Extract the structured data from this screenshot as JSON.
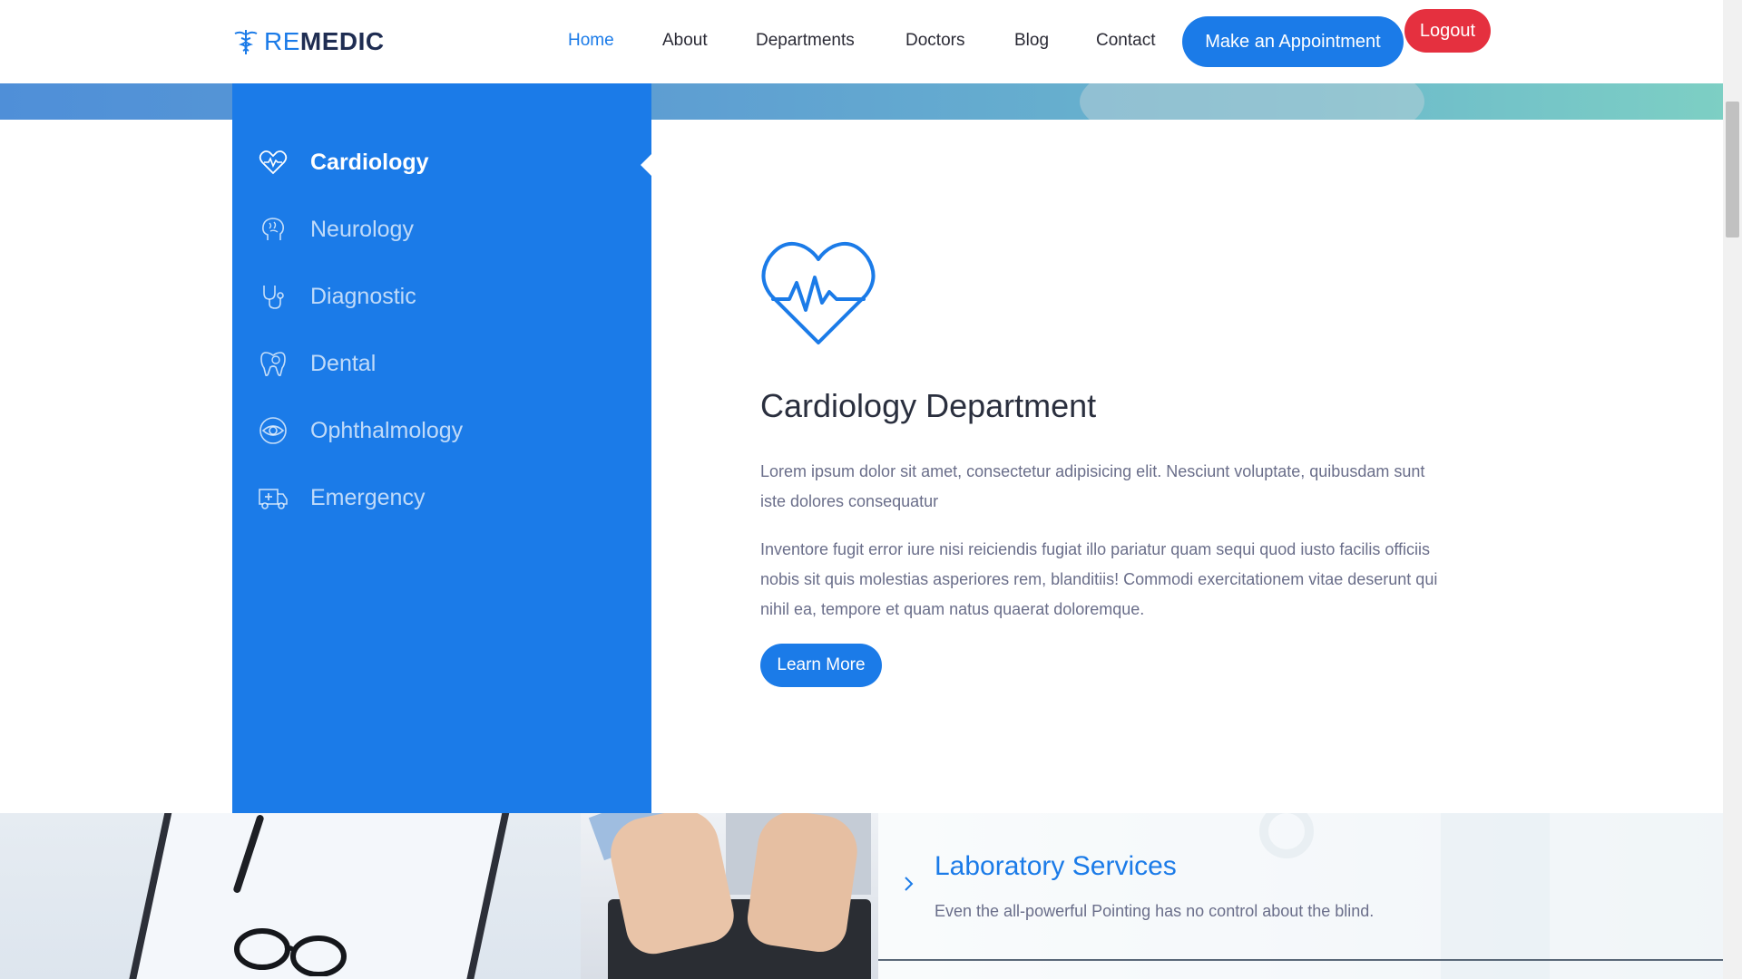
{
  "logo": {
    "part1": "RE",
    "part2": "MEDIC"
  },
  "nav": {
    "links": [
      {
        "label": "Home",
        "active": true
      },
      {
        "label": "About"
      },
      {
        "label": "Departments"
      },
      {
        "label": "Doctors"
      },
      {
        "label": "Blog"
      },
      {
        "label": "Contact"
      }
    ],
    "appointment_label": "Make an Appointment",
    "logout_label": "Logout"
  },
  "departments": {
    "items": [
      {
        "label": "Cardiology",
        "icon": "heart-pulse-icon",
        "active": true
      },
      {
        "label": "Neurology",
        "icon": "brain-icon"
      },
      {
        "label": "Diagnostic",
        "icon": "stethoscope-icon"
      },
      {
        "label": "Dental",
        "icon": "tooth-icon"
      },
      {
        "label": "Ophthalmology",
        "icon": "eye-icon"
      },
      {
        "label": "Emergency",
        "icon": "ambulance-icon"
      }
    ],
    "detail": {
      "title": "Cardiology Department",
      "paragraph1": "Lorem ipsum dolor sit amet, consectetur adipisicing elit. Nesciunt voluptate, quibusdam sunt iste dolores consequatur",
      "paragraph2": "Inventore fugit error iure nisi reiciendis fugiat illo pariatur quam sequi quod iusto facilis officiis nobis sit quis molestias asperiores rem, blanditiis! Commodi exercitationem vitae deserunt qui nihil ea, tempore et quam natus quaerat doloremque.",
      "button_label": "Learn More"
    }
  },
  "services": {
    "title": "Laboratory Services",
    "text": "Even the all-powerful Pointing has no control about the blind."
  },
  "colors": {
    "primary": "#1b7be8",
    "danger": "#e5303f",
    "heading": "#2a2f3e",
    "body_text": "#6a6e8a"
  }
}
